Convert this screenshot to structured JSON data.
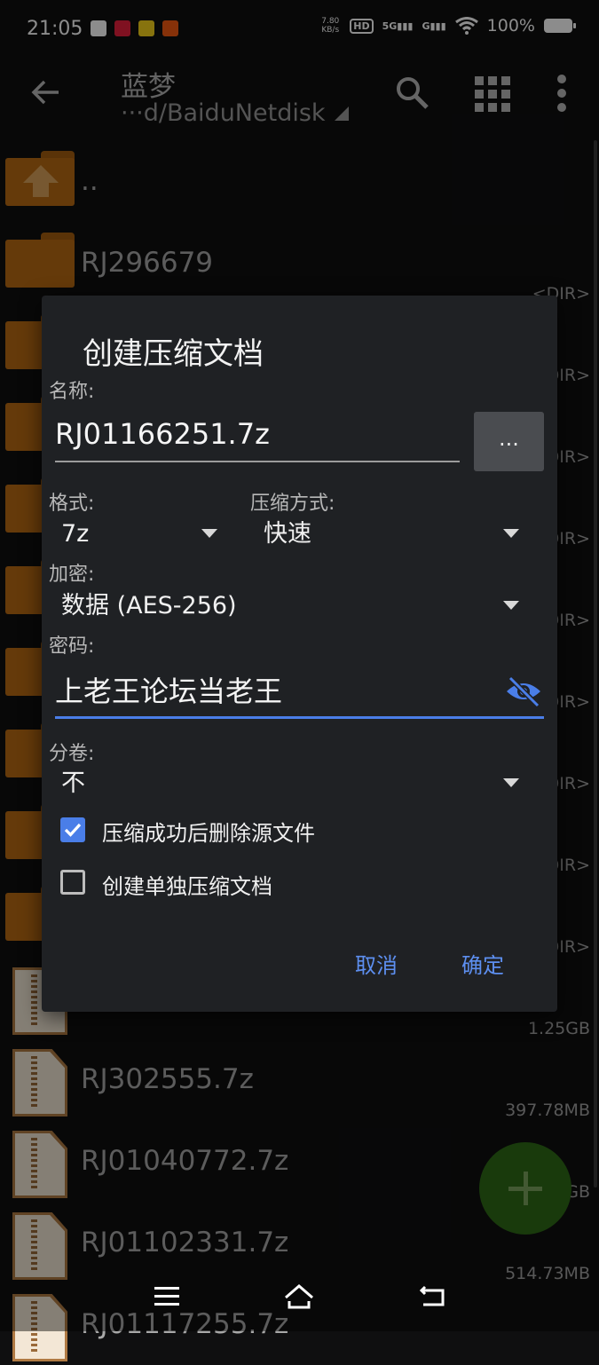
{
  "status_bar": {
    "time": "21:05",
    "notification_icons": [
      "clipboard-check-icon",
      "gift-app-icon",
      "lemon-app-icon",
      "taobao-app-icon"
    ],
    "net_speed_value": "7.80",
    "net_speed_unit": "KB/s",
    "hd": "HD",
    "signal_5g": "5G",
    "signal_g": "G",
    "battery": "100%"
  },
  "app_bar": {
    "title": "蓝梦",
    "path": "···d/BaiduNetdisk"
  },
  "file_list": {
    "items": [
      {
        "name": "..",
        "meta": "",
        "type": "up"
      },
      {
        "name": "RJ296679",
        "meta": "<DIR>",
        "type": "folder"
      },
      {
        "name": "",
        "meta": "DIR>",
        "type": "folder"
      },
      {
        "name": "",
        "meta": "DIR>",
        "type": "folder"
      },
      {
        "name": "",
        "meta": "DIR>",
        "type": "folder"
      },
      {
        "name": "",
        "meta": "DIR>",
        "type": "folder"
      },
      {
        "name": "",
        "meta": "DIR>",
        "type": "folder"
      },
      {
        "name": "",
        "meta": "DIR>",
        "type": "folder"
      },
      {
        "name": "",
        "meta": "DIR>",
        "type": "folder"
      },
      {
        "name": "",
        "meta": "DIR>",
        "type": "folder"
      },
      {
        "name": "",
        "meta": "1.25GB",
        "type": "zip"
      },
      {
        "name": "RJ302555.7z",
        "meta": "397.78MB",
        "type": "zip"
      },
      {
        "name": "RJ01040772.7z",
        "meta": "GB",
        "type": "zip"
      },
      {
        "name": "RJ01102331.7z",
        "meta": "514.73MB",
        "type": "zip"
      },
      {
        "name": "RJ01117255.7z",
        "meta": "",
        "type": "zip"
      }
    ]
  },
  "dialog": {
    "title": "创建压缩文档",
    "name_label": "名称:",
    "name_value": "RJ01166251.7z",
    "browse_label": "...",
    "format_label": "格式:",
    "format_value": "7z",
    "method_label": "压缩方式:",
    "method_value": "快速",
    "encryption_label": "加密:",
    "encryption_value": "数据 (AES-256)",
    "password_label": "密码:",
    "password_value": "上老王论坛当老王",
    "split_label": "分卷:",
    "split_value": "不",
    "delete_source_label": "压缩成功后删除源文件",
    "delete_source_checked": true,
    "separate_archive_label": "创建单独压缩文档",
    "separate_archive_checked": false,
    "cancel_label": "取消",
    "ok_label": "确定"
  },
  "colors": {
    "accent": "#4a7ee8",
    "folder": "#b86b13",
    "fab": "#2f6a17",
    "dialog_bg": "#1f2124"
  }
}
